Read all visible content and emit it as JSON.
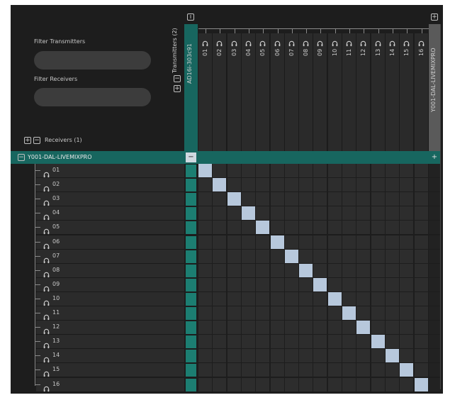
{
  "filters": {
    "transmitters_label": "Filter Transmitters",
    "receivers_label": "Filter Receivers"
  },
  "transmitters": {
    "header": "Transmitters (2)",
    "device": "AD16i-303c91",
    "device2": "Y001-DAL-LIVEMIXPRO",
    "channels": [
      "01",
      "02",
      "03",
      "04",
      "05",
      "06",
      "07",
      "08",
      "09",
      "10",
      "11",
      "12",
      "13",
      "14",
      "15",
      "16"
    ]
  },
  "receivers": {
    "header": "Receivers (1)",
    "device": "Y001-DAL-LIVEMIXPRO",
    "channels": [
      "01",
      "02",
      "03",
      "04",
      "05",
      "06",
      "07",
      "08",
      "09",
      "10",
      "11",
      "12",
      "13",
      "14",
      "15",
      "16"
    ]
  },
  "matrix": {
    "connections": [
      [
        1,
        1
      ],
      [
        2,
        2
      ],
      [
        3,
        3
      ],
      [
        4,
        4
      ],
      [
        5,
        5
      ],
      [
        6,
        6
      ],
      [
        7,
        7
      ],
      [
        8,
        8
      ],
      [
        9,
        9
      ],
      [
        10,
        10
      ],
      [
        11,
        11
      ],
      [
        12,
        12
      ],
      [
        13,
        13
      ],
      [
        14,
        14
      ],
      [
        15,
        15
      ],
      [
        16,
        16
      ]
    ]
  },
  "icons": {
    "expand": "+",
    "collapse": "−",
    "info": "i",
    "headphones": "headphones-icon"
  },
  "colors": {
    "background": "#1d1d1d",
    "cell": "#2d2d2d",
    "teal": "#17665f",
    "teal_cell": "#1c7e72",
    "connected": "#b7c8dc",
    "grey_column": "#5a5a5a"
  }
}
